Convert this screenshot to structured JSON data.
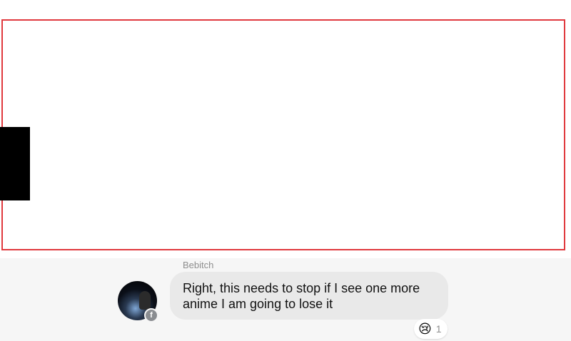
{
  "message": {
    "sender": "Bebitch",
    "text": "Right, this needs to stop if I see one more anime I am going to lose it",
    "avatar_icon": "profile-photo",
    "platform_badge_icon": "facebook-icon",
    "platform_badge_glyph": "f",
    "reaction": {
      "emoji": "😢",
      "emoji_name": "crying-face-icon",
      "count": "1"
    }
  },
  "colors": {
    "overlay_border": "#e0393e",
    "bubble": "#e9e9e9",
    "chat_background": "#f6f6f6"
  }
}
